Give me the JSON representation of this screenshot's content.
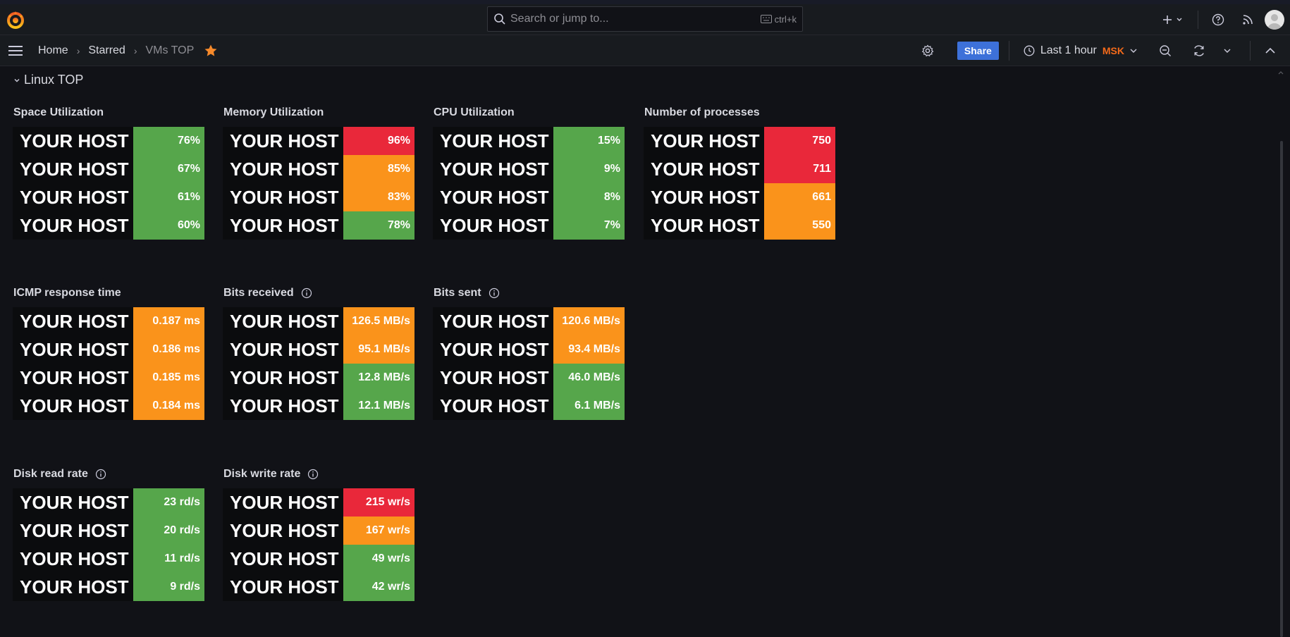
{
  "search": {
    "placeholder": "Search or jump to...",
    "shortcut": "ctrl+k"
  },
  "breadcrumb": {
    "home": "Home",
    "starred": "Starred",
    "current": "VMs TOP"
  },
  "toolbar": {
    "share_label": "Share",
    "time_range": "Last 1 hour",
    "timezone": "MSK"
  },
  "row": {
    "title": "Linux TOP"
  },
  "colors": {
    "green": "#56a64b",
    "orange": "#fa931b",
    "red": "#e9283a",
    "share": "#3d71d9",
    "accent": "#f46a1a"
  },
  "panels": [
    {
      "title": "Space Utilization",
      "info": false,
      "rows": [
        {
          "name": "YOUR HOST",
          "value": "76%",
          "level": "green"
        },
        {
          "name": "YOUR HOST",
          "value": "67%",
          "level": "green"
        },
        {
          "name": "YOUR HOST",
          "value": "61%",
          "level": "green"
        },
        {
          "name": "YOUR HOST",
          "value": "60%",
          "level": "green"
        }
      ]
    },
    {
      "title": "Memory Utilization",
      "info": false,
      "rows": [
        {
          "name": "YOUR HOST",
          "value": "96%",
          "level": "red"
        },
        {
          "name": "YOUR HOST",
          "value": "85%",
          "level": "orange"
        },
        {
          "name": "YOUR HOST",
          "value": "83%",
          "level": "orange"
        },
        {
          "name": "YOUR HOST",
          "value": "78%",
          "level": "green"
        }
      ]
    },
    {
      "title": "CPU Utilization",
      "info": false,
      "rows": [
        {
          "name": "YOUR HOST",
          "value": "15%",
          "level": "green"
        },
        {
          "name": "YOUR HOST",
          "value": "9%",
          "level": "green"
        },
        {
          "name": "YOUR HOST",
          "value": "8%",
          "level": "green"
        },
        {
          "name": "YOUR HOST",
          "value": "7%",
          "level": "green"
        }
      ]
    },
    {
      "title": "Number of processes",
      "info": false,
      "rows": [
        {
          "name": "YOUR HOST",
          "value": "750",
          "level": "red"
        },
        {
          "name": "YOUR HOST",
          "value": "711",
          "level": "red"
        },
        {
          "name": "YOUR HOST",
          "value": "661",
          "level": "orange"
        },
        {
          "name": "YOUR HOST",
          "value": "550",
          "level": "orange"
        }
      ]
    },
    {
      "title": "ICMP response time",
      "info": false,
      "rows": [
        {
          "name": "YOUR HOST",
          "value": "0.187 ms",
          "level": "orange"
        },
        {
          "name": "YOUR HOST",
          "value": "0.186 ms",
          "level": "orange"
        },
        {
          "name": "YOUR HOST",
          "value": "0.185 ms",
          "level": "orange"
        },
        {
          "name": "YOUR HOST",
          "value": "0.184 ms",
          "level": "orange"
        }
      ]
    },
    {
      "title": "Bits received",
      "info": true,
      "rows": [
        {
          "name": "YOUR HOST",
          "value": "126.5 MB/s",
          "level": "orange"
        },
        {
          "name": "YOUR HOST",
          "value": "95.1 MB/s",
          "level": "orange"
        },
        {
          "name": "YOUR HOST",
          "value": "12.8 MB/s",
          "level": "green"
        },
        {
          "name": "YOUR HOST",
          "value": "12.1 MB/s",
          "level": "green"
        }
      ]
    },
    {
      "title": "Bits sent",
      "info": true,
      "rows": [
        {
          "name": "YOUR HOST",
          "value": "120.6 MB/s",
          "level": "orange"
        },
        {
          "name": "YOUR HOST",
          "value": "93.4 MB/s",
          "level": "orange"
        },
        {
          "name": "YOUR HOST",
          "value": "46.0 MB/s",
          "level": "green"
        },
        {
          "name": "YOUR HOST",
          "value": "6.1 MB/s",
          "level": "green"
        }
      ]
    },
    {
      "title": "Disk read rate",
      "info": true,
      "rows": [
        {
          "name": "YOUR HOST",
          "value": "23 rd/s",
          "level": "green"
        },
        {
          "name": "YOUR HOST",
          "value": "20 rd/s",
          "level": "green"
        },
        {
          "name": "YOUR HOST",
          "value": "11 rd/s",
          "level": "green"
        },
        {
          "name": "YOUR HOST",
          "value": "9 rd/s",
          "level": "green"
        }
      ]
    },
    {
      "title": "Disk write rate",
      "info": true,
      "rows": [
        {
          "name": "YOUR HOST",
          "value": "215 wr/s",
          "level": "red"
        },
        {
          "name": "YOUR HOST",
          "value": "167 wr/s",
          "level": "orange"
        },
        {
          "name": "YOUR HOST",
          "value": "49 wr/s",
          "level": "green"
        },
        {
          "name": "YOUR HOST",
          "value": "42 wr/s",
          "level": "green"
        }
      ]
    }
  ]
}
